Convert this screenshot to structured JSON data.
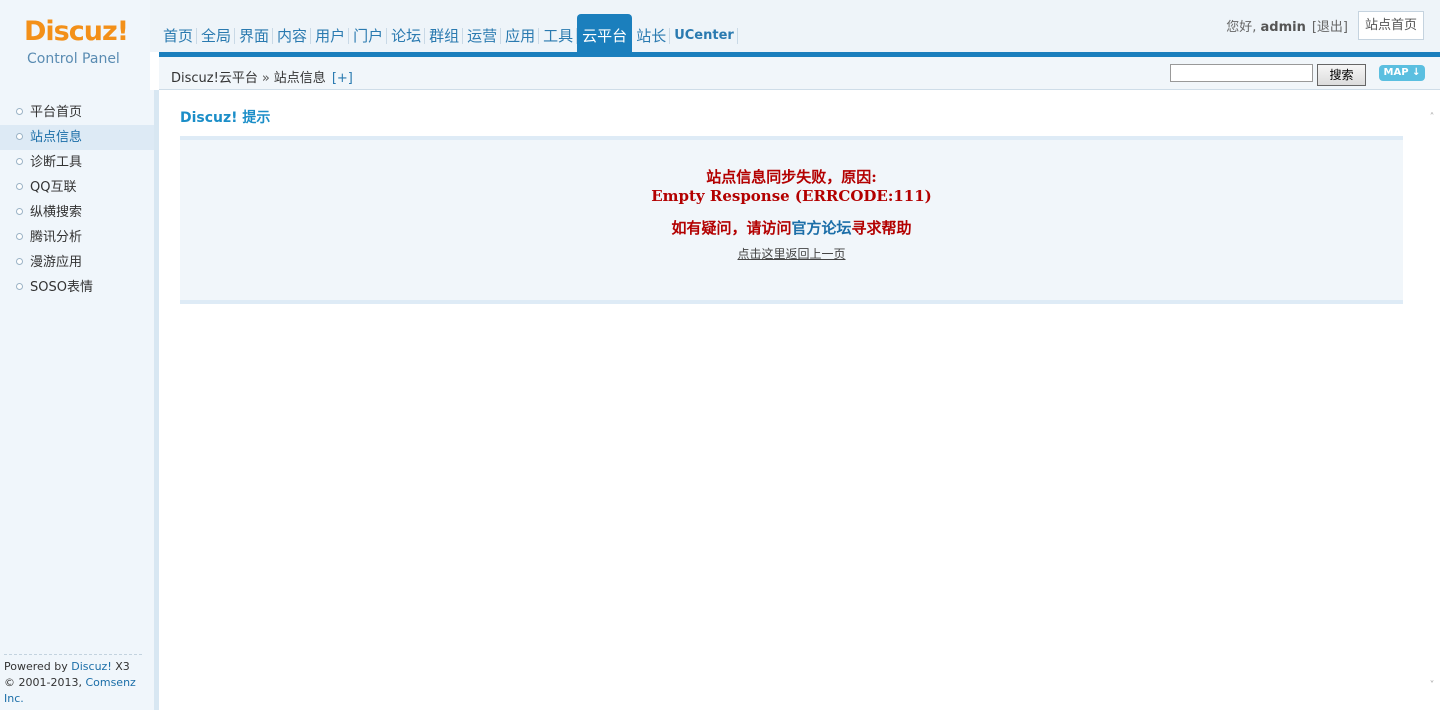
{
  "logo": {
    "brand": "Discuz",
    "brand_mark": "!",
    "subtitle": "Control Panel"
  },
  "nav": {
    "items": [
      {
        "label": "首页"
      },
      {
        "label": "全局"
      },
      {
        "label": "界面"
      },
      {
        "label": "内容"
      },
      {
        "label": "用户"
      },
      {
        "label": "门户"
      },
      {
        "label": "论坛"
      },
      {
        "label": "群组"
      },
      {
        "label": "运营"
      },
      {
        "label": "应用"
      },
      {
        "label": "工具"
      },
      {
        "label": "云平台"
      },
      {
        "label": "站长"
      },
      {
        "label": "UCenter"
      }
    ],
    "active": "云平台"
  },
  "user": {
    "greeting": "您好,",
    "username": "admin",
    "logout": "[退出]",
    "home_button": "站点首页"
  },
  "breadcrumb": {
    "root": "Discuz!云平台",
    "separator": "»",
    "current": "站点信息",
    "add": "[+]"
  },
  "search": {
    "value": "",
    "button": "搜索"
  },
  "map_button": "MAP",
  "map_icon": "arrow-down-icon",
  "sidebar": {
    "items": [
      {
        "label": "平台首页"
      },
      {
        "label": "站点信息"
      },
      {
        "label": "诊断工具"
      },
      {
        "label": "QQ互联"
      },
      {
        "label": "纵横搜索"
      },
      {
        "label": "腾讯分析"
      },
      {
        "label": "漫游应用"
      },
      {
        "label": "SOSO表情"
      }
    ],
    "active_index": 1,
    "footer": {
      "powered_prefix": "Powered by",
      "powered_link": "Discuz!",
      "version": "X3",
      "copyright": "© 2001-2013,",
      "company": "Comsenz Inc."
    }
  },
  "content": {
    "title": "Discuz! 提示",
    "message_line1": "站点信息同步失败，原因:",
    "message_line2": "Empty Response (ERRCODE:111)",
    "help_prefix": "如有疑问，请访问",
    "help_link": "官方论坛",
    "help_suffix": "寻求帮助",
    "back_link": "点击这里返回上一页"
  },
  "colors": {
    "accent": "#1b7fbd",
    "logo": "#f39019",
    "error": "#b30000"
  }
}
